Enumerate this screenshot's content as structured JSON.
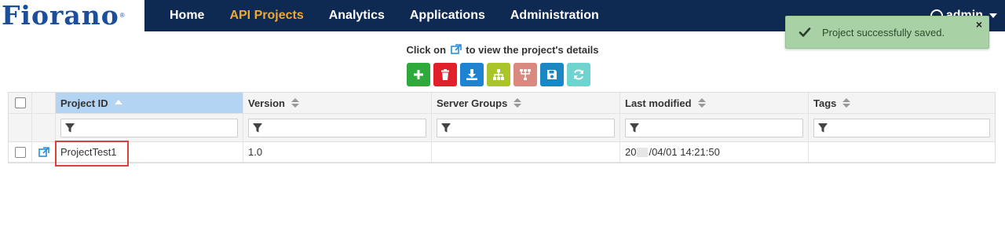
{
  "header": {
    "logo_text": "Fiorano",
    "logo_mark": "®",
    "nav": [
      {
        "label": "Home",
        "active": false
      },
      {
        "label": "API Projects",
        "active": true
      },
      {
        "label": "Analytics",
        "active": false
      },
      {
        "label": "Applications",
        "active": false
      },
      {
        "label": "Administration",
        "active": false
      }
    ],
    "user": "admin",
    "colors": {
      "bar": "#0f2a52",
      "active": "#f0a830",
      "logo": "#1b4f9c"
    }
  },
  "toast": {
    "message": "Project successfully saved.",
    "close": "×",
    "icon": "check-icon",
    "color": "#a8d2a6"
  },
  "hint": {
    "before": "Click on",
    "after": "to view the project's details",
    "icon": "external-link-icon"
  },
  "toolbar": [
    {
      "name": "add-button",
      "icon": "plus-icon",
      "color": "#2eaa3c"
    },
    {
      "name": "delete-button",
      "icon": "trash-icon",
      "color": "#e0202a"
    },
    {
      "name": "import-button",
      "icon": "download-icon",
      "color": "#1e84d2"
    },
    {
      "name": "hierarchy-button",
      "icon": "sitemap-icon",
      "color": "#a9c52a"
    },
    {
      "name": "deploy-button",
      "icon": "network-icon",
      "color": "#d9897f"
    },
    {
      "name": "save-button",
      "icon": "save-icon",
      "color": "#1a86c2"
    },
    {
      "name": "refresh-button",
      "icon": "refresh-icon",
      "color": "#6fd3d0"
    }
  ],
  "table": {
    "columns": [
      "Project ID",
      "Version",
      "Server Groups",
      "Last modified",
      "Tags"
    ],
    "sorted_column": "Project ID",
    "rows": [
      {
        "project_id": "ProjectTest1",
        "version": "1.0",
        "server_groups": "",
        "last_modified_prefix": "20",
        "last_modified_suffix": "/04/01 14:21:50",
        "tags": ""
      }
    ]
  }
}
